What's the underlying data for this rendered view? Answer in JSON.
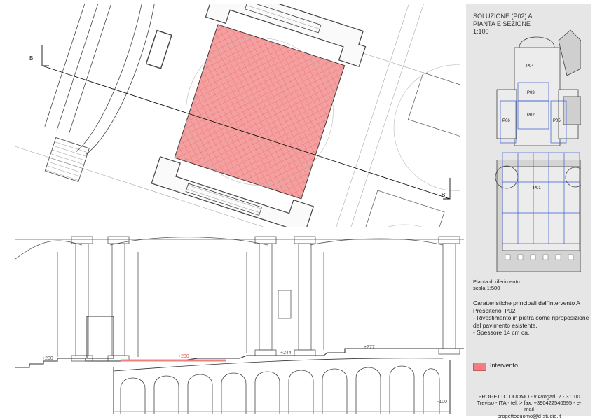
{
  "panel": {
    "title_lines": [
      "SOLUZIONE (P02) A",
      "PIANTA E SEZIONE",
      "1:100"
    ],
    "ref_lines": [
      "Pianta di riferimento",
      "scala 1:500"
    ],
    "desc_lines": [
      "Caratteristiche principali dell'intervento A",
      "Presbiterio_P02",
      "- Rivestimento in pietra come riproposizione",
      "del pavimento esistente.",
      "- Spessore 14 cm ca."
    ],
    "legend_label": "Intervento",
    "footer_lines": [
      "PROGETTO DUOMO - v.Avogari, 2 - 31100",
      "Treviso - ITA - tel. > fax. +390422540595 - e-mail",
      "progettoduomo@d-studio.it"
    ]
  },
  "mini_plan": {
    "zones": [
      "P04",
      "P03",
      "P02",
      "P06",
      "P05",
      "P01"
    ]
  },
  "plan": {
    "section_marker_left": "B",
    "section_marker_right": "B'"
  },
  "section": {
    "levels": [
      "+230",
      "+244",
      "+277",
      "+200",
      "-100"
    ]
  },
  "colors": {
    "intervento_fill": "#f08080",
    "panel_bg": "#e6e6e6",
    "line": "#333333"
  }
}
